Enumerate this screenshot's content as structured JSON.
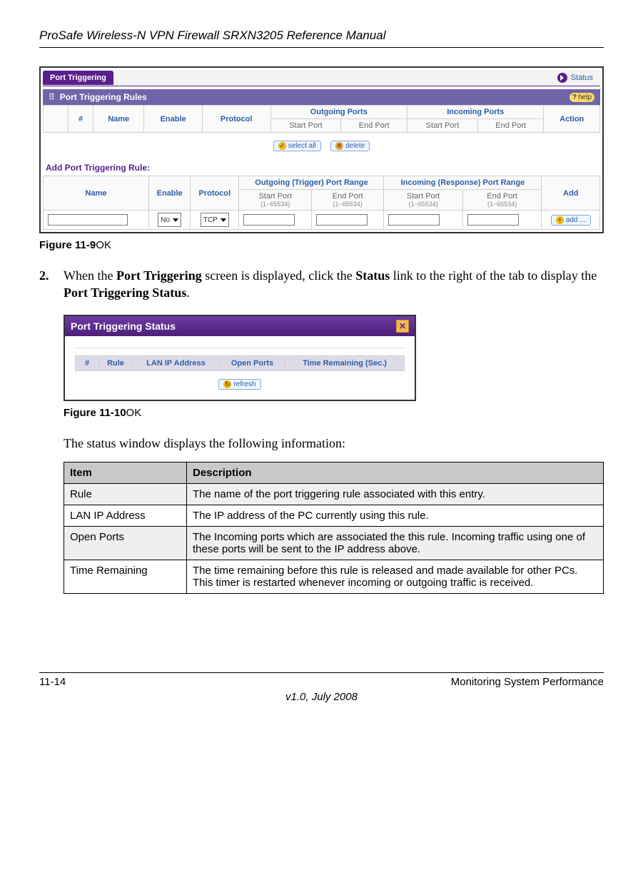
{
  "header": {
    "title": "ProSafe Wireless-N VPN Firewall SRXN3205 Reference Manual"
  },
  "ss1": {
    "tab_label": "Port Triggering",
    "status_link": "Status",
    "rules_section": "Port Triggering Rules",
    "help_label": "help",
    "cols": {
      "num": "#",
      "name": "Name",
      "enable": "Enable",
      "protocol": "Protocol",
      "outgoing": "Outgoing Ports",
      "incoming": "Incoming Ports",
      "action": "Action",
      "start": "Start Port",
      "end": "End Port"
    },
    "btn_select_all": "select all",
    "btn_delete": "delete",
    "add_section": "Add Port Triggering Rule:",
    "add_cols": {
      "name": "Name",
      "enable": "Enable",
      "protocol": "Protocol",
      "out_range": "Outgoing (Trigger) Port Range",
      "in_range": "Incoming (Response) Port Range",
      "add": "Add",
      "start": "Start Port",
      "end": "End Port",
      "hint": "(1~65534)"
    },
    "enable_sel": "No",
    "proto_sel": "TCP",
    "btn_add": "add ..."
  },
  "fig1": {
    "num": "Figure 11-9",
    "suffix": "OK"
  },
  "step2": {
    "num": "2.",
    "text_a": "When the ",
    "bold_a": "Port Triggering",
    "text_b": " screen is displayed, click the ",
    "bold_b": "Status",
    "text_c": " link to the right of the tab to display the ",
    "bold_c": "Port Triggering Status",
    "text_d": "."
  },
  "ss2": {
    "title": "Port Triggering Status",
    "cols": {
      "num": "#",
      "rule": "Rule",
      "ip": "LAN IP Address",
      "ports": "Open Ports",
      "time": "Time Remaining (Sec.)"
    },
    "btn_refresh": "refresh"
  },
  "fig2": {
    "num": "Figure 11-10",
    "suffix": "OK"
  },
  "intro_status": "The status window displays the following information:",
  "desc": {
    "h_item": "Item",
    "h_desc": "Description",
    "rows": [
      {
        "item": "Rule",
        "desc": "The name of the port triggering rule associated with this entry."
      },
      {
        "item": "LAN IP Address",
        "desc": "The IP address of the PC currently using this rule."
      },
      {
        "item": "Open Ports",
        "desc": "The Incoming ports which are associated the this rule. Incoming traffic using one of these ports will be sent to the IP address above."
      },
      {
        "item": "Time Remaining",
        "desc": "The time remaining before this rule is released and made available for other PCs. This timer is restarted whenever incoming or outgoing traffic is received."
      }
    ]
  },
  "footer": {
    "page": "11-14",
    "section": "Monitoring System Performance",
    "version": "v1.0, July 2008"
  }
}
